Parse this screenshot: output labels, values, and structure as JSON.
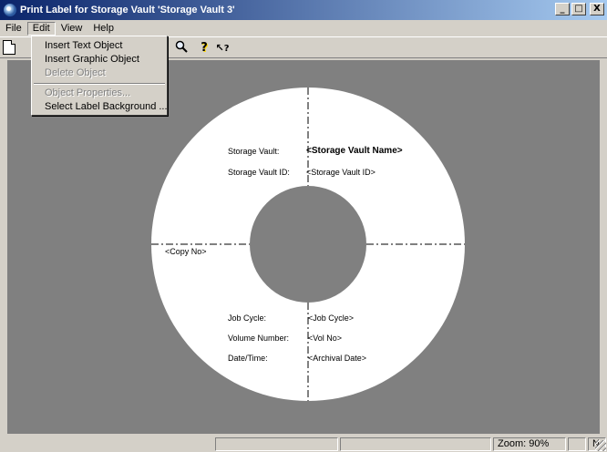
{
  "window": {
    "title": "Print Label for Storage Vault 'Storage Vault 3'",
    "minimize": "_",
    "maximize": "□",
    "close": "X"
  },
  "menubar": {
    "file": "File",
    "edit": "Edit",
    "view": "View",
    "help": "Help"
  },
  "toolbar": {
    "zoom_glyph": "🔍",
    "help_glyph": "?",
    "context_help_glyph": "?"
  },
  "edit_menu": {
    "insert_text": "Insert Text Object",
    "insert_graphic": "Insert Graphic Object",
    "delete_object": "Delete Object",
    "object_properties": "Object Properties...",
    "select_background": "Select Label Background ..."
  },
  "label": {
    "storage_vault_label": "Storage Vault:",
    "storage_vault_value": "<Storage Vault Name>",
    "storage_vault_id_label": "Storage Vault ID:",
    "storage_vault_id_value": "<Storage Vault ID>",
    "copy_no": "<Copy No>",
    "job_cycle_label": "Job Cycle:",
    "job_cycle_value": "<Job Cycle>",
    "volume_number_label": "Volume Number:",
    "volume_number_value": "<Vol No>",
    "date_time_label": "Date/Time:",
    "date_time_value": "<Archival Date>"
  },
  "statusbar": {
    "zoom": "Zoom: 90%",
    "mode": "N"
  },
  "icons": {
    "app": "disc-app-icon",
    "new": "new-document-icon",
    "zoom": "magnifier-icon",
    "help": "help-icon",
    "context_help": "context-help-icon"
  },
  "colors": {
    "titlebar_start": "#0a246a",
    "titlebar_end": "#a6caf0",
    "workspace": "#808080",
    "chrome": "#d4d0c8",
    "label_disc": "#ffffff"
  }
}
